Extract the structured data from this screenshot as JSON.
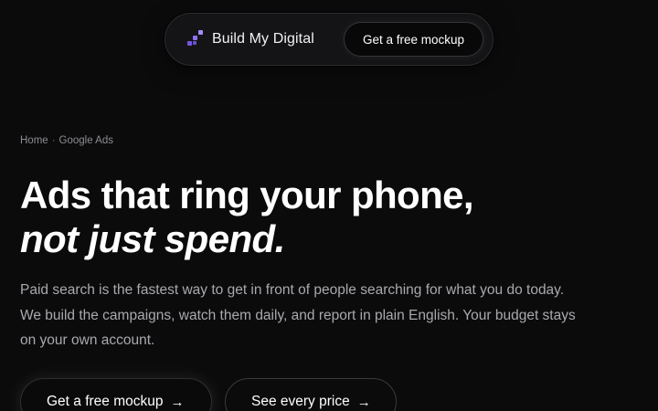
{
  "nav": {
    "brand_name": "Build My Digital",
    "brand_icon": "pixel-stairs-logo-icon",
    "cta_label": "Get a free mockup"
  },
  "breadcrumb": {
    "home": "Home",
    "separator": "·",
    "current": "Google Ads"
  },
  "hero": {
    "title_line1": "Ads that ring your phone,",
    "title_line2": "not just spend.",
    "description": "Paid search is the fastest way to get in front of people searching for what you do today. We build the campaigns, watch them daily, and report in plain English. Your budget stays on your own account.",
    "primary_cta": "Get a free mockup",
    "secondary_cta": "See every price",
    "arrow_icon": "→"
  },
  "colors": {
    "background": "#0b0b0c",
    "accent": "#8b6cf0"
  }
}
